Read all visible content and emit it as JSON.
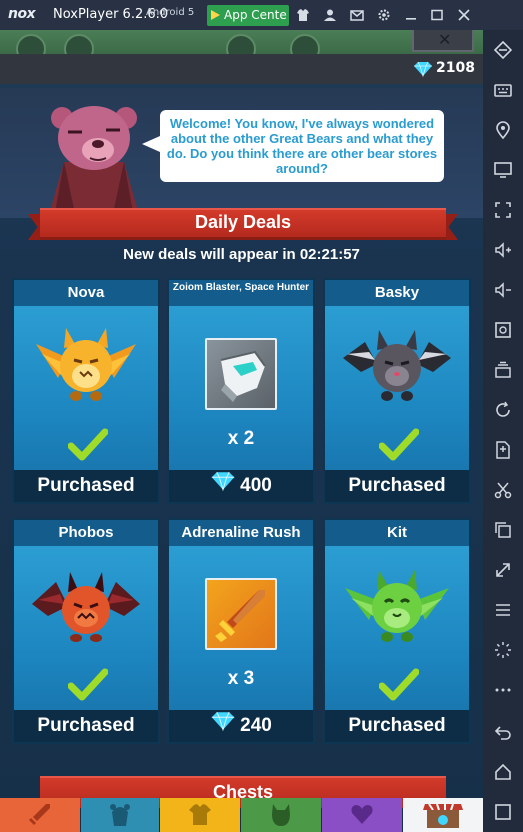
{
  "window": {
    "app_name": "NoxPlayer 6.2.6.0",
    "logo": "nox",
    "android_label": "Android 5",
    "app_center_label": "App Cente"
  },
  "currency": {
    "gems": "2108"
  },
  "dialog": {
    "text": "Welcome! You know, I've always wondered about the other Great Bears and what they do. Do you think there are other bear stores around?"
  },
  "daily_deals": {
    "title": "Daily Deals",
    "timer_text": "New deals will appear in 02:21:57",
    "cards": [
      {
        "name": "Nova",
        "status": "Purchased"
      },
      {
        "name": "Zoiom Blaster, Space Hunter",
        "qty": "x 2",
        "price": "400"
      },
      {
        "name": "Basky",
        "status": "Purchased"
      },
      {
        "name": "Phobos",
        "status": "Purchased"
      },
      {
        "name": "Adrenaline Rush",
        "qty": "x 3",
        "price": "240"
      },
      {
        "name": "Kit",
        "status": "Purchased"
      }
    ]
  },
  "chests": {
    "title": "Chests"
  },
  "colors": {
    "card_blue": "#2fa3d6",
    "banner_red": "#d33a2a",
    "check_green": "#9fdc2a",
    "gem_cyan": "#3fd6ff",
    "app_center_green": "#2e9f4e"
  },
  "tabs": [
    "sword-icon",
    "bear-head-icon",
    "shirt-icon",
    "creature-icon",
    "heart-icon",
    "shop-icon"
  ]
}
